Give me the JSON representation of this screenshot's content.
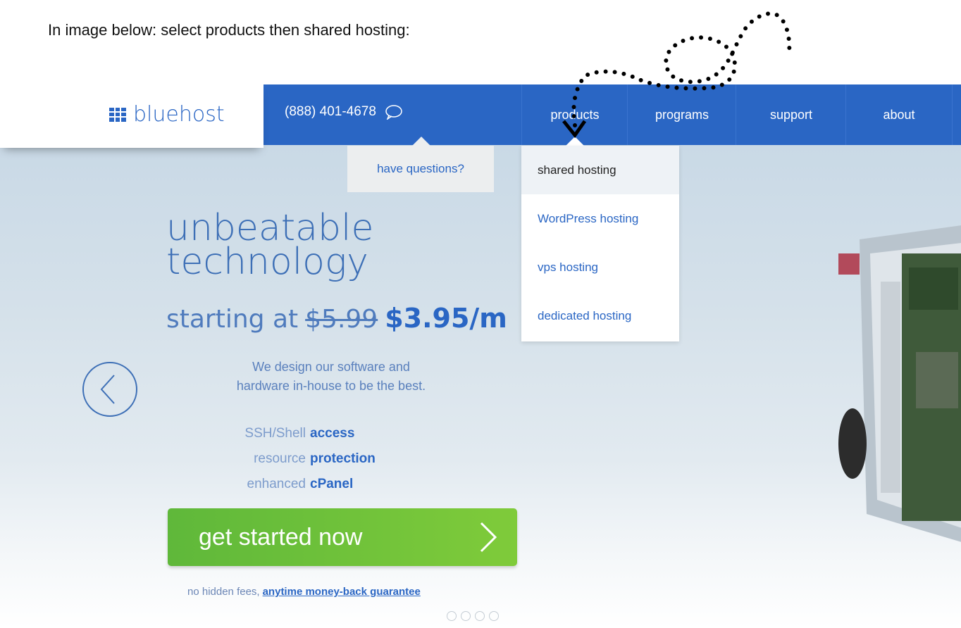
{
  "instruction": "In image below: select products then shared hosting:",
  "brand": {
    "name": "bluehost",
    "color": "#2a66c4"
  },
  "header": {
    "phone": "(888) 401-4678",
    "nav": [
      "products",
      "programs",
      "support",
      "about"
    ],
    "questions_label": "have questions?"
  },
  "dropdown": {
    "items": [
      "shared hosting",
      "WordPress hosting",
      "vps hosting",
      "dedicated hosting"
    ],
    "highlighted": "shared hosting"
  },
  "hero": {
    "headline_1": "unbeatable",
    "headline_2": "technology",
    "price_prefix": "starting at",
    "old_price": "$5.99",
    "new_price": "$3.95/m",
    "tagline_1": "We design our software and",
    "tagline_2": "hardware in-house to be the best.",
    "features": [
      {
        "light": "SSH/Shell",
        "bold": "access"
      },
      {
        "light": "resource",
        "bold": "protection"
      },
      {
        "light": "enhanced",
        "bold": "cPanel"
      }
    ],
    "cta_label": "get started now",
    "guarantee_prefix": "no hidden fees,",
    "guarantee_link": "anytime money-back guarantee",
    "carousel_dots": 4
  },
  "colors": {
    "nav_bg": "#2a66c4",
    "cta_green": "#6cc03a",
    "annotation": "#000000"
  },
  "icons": [
    "chat-bubble-icon",
    "chevron-left-icon",
    "chevron-right-icon",
    "logo-grid-icon"
  ]
}
